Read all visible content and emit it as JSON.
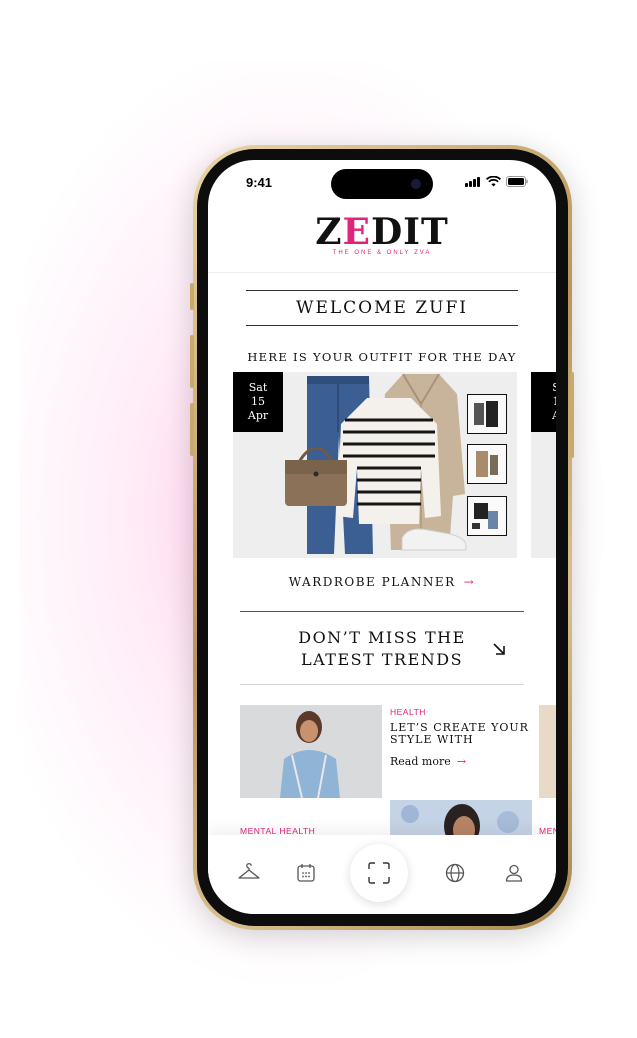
{
  "status_bar": {
    "time": "9:41"
  },
  "brand": {
    "logo_lead": "Z",
    "logo_accent": "E",
    "logo_rest": "DIT",
    "tagline": "THE ONE & ONLY ZVA"
  },
  "greeting": "WELCOME ZUFI",
  "outfit_section": {
    "heading": "HERE IS YOUR OUTFIT FOR THE DAY",
    "cards": [
      {
        "day": "Sat",
        "date": "15",
        "month": "Apr"
      },
      {
        "day": "S",
        "date": "1",
        "month": "A"
      }
    ]
  },
  "wardrobe_planner": {
    "label": "WARDROBE PLANNER",
    "arrow": "→"
  },
  "trends": {
    "line1": "DON’T MISS THE",
    "line2": "LATEST TRENDS"
  },
  "articles": [
    {
      "category": "HEALTH",
      "title": "LET’S CREATE YOUR STYLE WITH",
      "link_label": "Read more",
      "link_arrow": "→"
    },
    {
      "category": "MENTAL HEALTH"
    },
    {
      "category": "MEN"
    }
  ],
  "bottom_nav": {
    "items": [
      {
        "icon": "hanger-icon"
      },
      {
        "icon": "calendar-icon"
      },
      {
        "icon": "scan-icon"
      },
      {
        "icon": "globe-icon"
      },
      {
        "icon": "profile-icon"
      }
    ]
  },
  "colors": {
    "accent": "#e0247a",
    "frame_gold": "#c8aa6f",
    "text": "#111111"
  }
}
